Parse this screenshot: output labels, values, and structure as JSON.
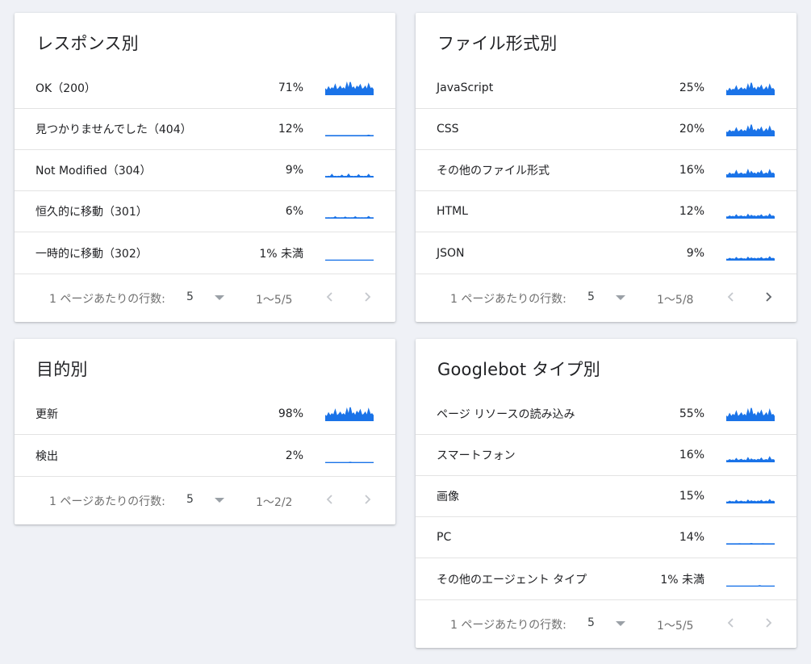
{
  "colors": {
    "spark": "#1a73e8",
    "chevron_disabled": "#c4c7cc",
    "chevron_enabled": "#5f6368"
  },
  "cards": [
    {
      "title": "レスポンス別",
      "rows": [
        {
          "label": "OK（200）",
          "pct": "71%",
          "spark": [
            0.45,
            0.3,
            0.55,
            0.35,
            0.5,
            0.4,
            0.7,
            0.35,
            0.45,
            0.6,
            0.4,
            0.5,
            0.35,
            0.8,
            0.4,
            0.9,
            0.45,
            0.55,
            0.35,
            0.6,
            0.5,
            0.7,
            0.4,
            0.45,
            0.6,
            0.35,
            0.75,
            0.45,
            0.5,
            0.35
          ]
        },
        {
          "label": "見つかりませんでした（404）",
          "pct": "12%",
          "spark": [
            0.05,
            0.05,
            0.05,
            0.05,
            0.05,
            0.05,
            0.05,
            0.05,
            0.05,
            0.05,
            0.05,
            0.05,
            0.05,
            0.05,
            0.05,
            0.05,
            0.05,
            0.05,
            0.05,
            0.05,
            0.05,
            0.05,
            0.05,
            0.05,
            0.05,
            0.05,
            0.08,
            0.05,
            0.05,
            0.05
          ]
        },
        {
          "label": "Not Modified（304）",
          "pct": "9%",
          "spark": [
            0.08,
            0.06,
            0.08,
            0.06,
            0.2,
            0.06,
            0.08,
            0.06,
            0.08,
            0.06,
            0.15,
            0.06,
            0.08,
            0.06,
            0.22,
            0.06,
            0.08,
            0.06,
            0.08,
            0.06,
            0.18,
            0.06,
            0.08,
            0.06,
            0.08,
            0.06,
            0.2,
            0.06,
            0.08,
            0.06
          ]
        },
        {
          "label": "恒久的に移動（301）",
          "pct": "6%",
          "spark": [
            0.06,
            0.05,
            0.06,
            0.05,
            0.06,
            0.05,
            0.12,
            0.05,
            0.06,
            0.05,
            0.06,
            0.05,
            0.1,
            0.05,
            0.06,
            0.05,
            0.06,
            0.05,
            0.12,
            0.05,
            0.06,
            0.05,
            0.06,
            0.05,
            0.06,
            0.05,
            0.14,
            0.05,
            0.06,
            0.05
          ]
        },
        {
          "label": "一時的に移動（302）",
          "pct": "1% 未満",
          "spark": [
            0.03,
            0.03,
            0.03,
            0.03,
            0.03,
            0.03,
            0.03,
            0.03,
            0.03,
            0.03,
            0.03,
            0.03,
            0.03,
            0.03,
            0.03,
            0.03,
            0.03,
            0.03,
            0.03,
            0.03,
            0.03,
            0.03,
            0.03,
            0.03,
            0.03,
            0.03,
            0.03,
            0.03,
            0.03,
            0.03
          ]
        }
      ],
      "footer": {
        "rows_label": "1 ページあたりの行数:",
        "rows_value": "5",
        "range": "1〜5/5",
        "prev_enabled": false,
        "next_enabled": false
      }
    },
    {
      "title": "ファイル形式別",
      "rows": [
        {
          "label": "JavaScript",
          "pct": "25%",
          "spark": [
            0.35,
            0.25,
            0.45,
            0.3,
            0.4,
            0.35,
            0.6,
            0.3,
            0.4,
            0.5,
            0.35,
            0.45,
            0.3,
            0.7,
            0.35,
            0.85,
            0.4,
            0.5,
            0.3,
            0.55,
            0.45,
            0.65,
            0.35,
            0.4,
            0.55,
            0.3,
            0.7,
            0.4,
            0.45,
            0.3
          ]
        },
        {
          "label": "CSS",
          "pct": "20%",
          "spark": [
            0.3,
            0.25,
            0.4,
            0.3,
            0.35,
            0.3,
            0.55,
            0.3,
            0.35,
            0.45,
            0.3,
            0.4,
            0.3,
            0.65,
            0.35,
            0.8,
            0.35,
            0.45,
            0.3,
            0.5,
            0.4,
            0.6,
            0.3,
            0.35,
            0.5,
            0.3,
            0.65,
            0.35,
            0.4,
            0.3
          ]
        },
        {
          "label": "その他のファイル形式",
          "pct": "16%",
          "spark": [
            0.2,
            0.15,
            0.3,
            0.2,
            0.25,
            0.2,
            0.45,
            0.2,
            0.25,
            0.3,
            0.2,
            0.25,
            0.2,
            0.5,
            0.2,
            0.4,
            0.25,
            0.3,
            0.2,
            0.35,
            0.25,
            0.45,
            0.2,
            0.25,
            0.3,
            0.2,
            0.5,
            0.25,
            0.3,
            0.2
          ]
        },
        {
          "label": "HTML",
          "pct": "12%",
          "spark": [
            0.12,
            0.1,
            0.18,
            0.12,
            0.15,
            0.1,
            0.25,
            0.12,
            0.15,
            0.18,
            0.12,
            0.15,
            0.1,
            0.28,
            0.12,
            0.22,
            0.15,
            0.18,
            0.12,
            0.2,
            0.15,
            0.25,
            0.12,
            0.15,
            0.18,
            0.12,
            0.3,
            0.15,
            0.18,
            0.12
          ]
        },
        {
          "label": "JSON",
          "pct": "9%",
          "spark": [
            0.1,
            0.08,
            0.15,
            0.1,
            0.12,
            0.08,
            0.2,
            0.1,
            0.12,
            0.15,
            0.1,
            0.12,
            0.08,
            0.22,
            0.1,
            0.18,
            0.12,
            0.15,
            0.1,
            0.16,
            0.12,
            0.2,
            0.1,
            0.12,
            0.15,
            0.1,
            0.25,
            0.12,
            0.15,
            0.1
          ]
        }
      ],
      "footer": {
        "rows_label": "1 ページあたりの行数:",
        "rows_value": "5",
        "range": "1〜5/8",
        "prev_enabled": false,
        "next_enabled": true
      }
    },
    {
      "title": "目的別",
      "rows": [
        {
          "label": "更新",
          "pct": "98%",
          "spark": [
            0.4,
            0.3,
            0.55,
            0.35,
            0.5,
            0.4,
            0.75,
            0.35,
            0.45,
            0.6,
            0.4,
            0.5,
            0.35,
            0.8,
            0.4,
            0.95,
            0.45,
            0.55,
            0.35,
            0.65,
            0.5,
            0.75,
            0.4,
            0.45,
            0.6,
            0.35,
            0.8,
            0.45,
            0.5,
            0.35
          ]
        },
        {
          "label": "検出",
          "pct": "2%",
          "spark": [
            0.04,
            0.04,
            0.04,
            0.04,
            0.04,
            0.04,
            0.04,
            0.04,
            0.04,
            0.04,
            0.04,
            0.04,
            0.04,
            0.04,
            0.04,
            0.06,
            0.04,
            0.04,
            0.04,
            0.04,
            0.04,
            0.04,
            0.04,
            0.04,
            0.04,
            0.04,
            0.04,
            0.04,
            0.04,
            0.04
          ]
        }
      ],
      "footer": {
        "rows_label": "1 ページあたりの行数:",
        "rows_value": "5",
        "range": "1〜2/2",
        "prev_enabled": false,
        "next_enabled": false
      }
    },
    {
      "title": "Googlebot タイプ別",
      "rows": [
        {
          "label": "ページ リソースの読み込み",
          "pct": "55%",
          "spark": [
            0.35,
            0.25,
            0.5,
            0.3,
            0.45,
            0.35,
            0.65,
            0.3,
            0.4,
            0.55,
            0.35,
            0.45,
            0.3,
            0.75,
            0.35,
            0.9,
            0.4,
            0.5,
            0.3,
            0.6,
            0.45,
            0.7,
            0.35,
            0.4,
            0.55,
            0.3,
            0.75,
            0.4,
            0.45,
            0.3
          ]
        },
        {
          "label": "スマートフォン",
          "pct": "16%",
          "spark": [
            0.12,
            0.1,
            0.18,
            0.12,
            0.15,
            0.1,
            0.25,
            0.12,
            0.15,
            0.2,
            0.12,
            0.15,
            0.1,
            0.3,
            0.12,
            0.22,
            0.15,
            0.18,
            0.12,
            0.2,
            0.15,
            0.28,
            0.12,
            0.15,
            0.18,
            0.12,
            0.35,
            0.15,
            0.18,
            0.12
          ]
        },
        {
          "label": "画像",
          "pct": "15%",
          "spark": [
            0.1,
            0.08,
            0.15,
            0.1,
            0.12,
            0.08,
            0.2,
            0.1,
            0.12,
            0.15,
            0.1,
            0.12,
            0.08,
            0.22,
            0.1,
            0.18,
            0.12,
            0.15,
            0.1,
            0.16,
            0.12,
            0.2,
            0.1,
            0.12,
            0.15,
            0.1,
            0.25,
            0.12,
            0.15,
            0.1
          ]
        },
        {
          "label": "PC",
          "pct": "14%",
          "spark": [
            0.05,
            0.05,
            0.05,
            0.05,
            0.05,
            0.05,
            0.05,
            0.05,
            0.06,
            0.05,
            0.05,
            0.05,
            0.05,
            0.05,
            0.05,
            0.07,
            0.05,
            0.05,
            0.05,
            0.05,
            0.05,
            0.05,
            0.06,
            0.05,
            0.05,
            0.05,
            0.05,
            0.05,
            0.05,
            0.05
          ]
        },
        {
          "label": "その他のエージェント タイプ",
          "pct": "1% 未満",
          "spark": [
            0.03,
            0.03,
            0.03,
            0.03,
            0.03,
            0.03,
            0.03,
            0.03,
            0.03,
            0.03,
            0.03,
            0.03,
            0.03,
            0.03,
            0.03,
            0.03,
            0.03,
            0.03,
            0.03,
            0.03,
            0.06,
            0.03,
            0.03,
            0.03,
            0.03,
            0.03,
            0.03,
            0.03,
            0.03,
            0.03
          ]
        }
      ],
      "footer": {
        "rows_label": "1 ページあたりの行数:",
        "rows_value": "5",
        "range": "1〜5/5",
        "prev_enabled": false,
        "next_enabled": false
      }
    }
  ]
}
